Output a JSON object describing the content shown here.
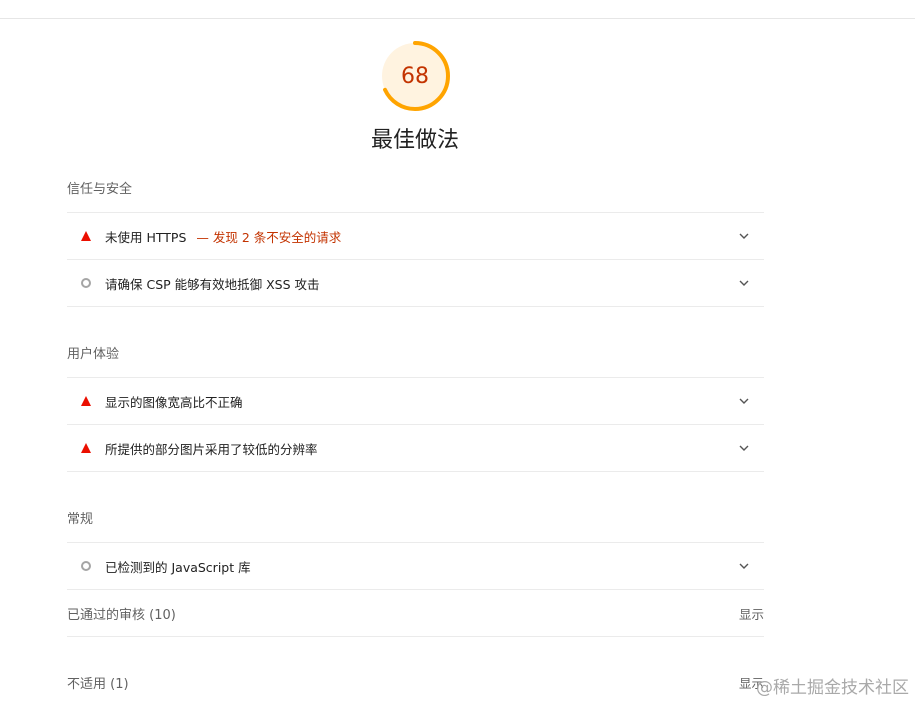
{
  "score": {
    "value": "68",
    "fraction": 0.68,
    "color": "#ffa400"
  },
  "category": {
    "title": "最佳做法"
  },
  "groups": [
    {
      "title": "信任与安全",
      "audits": [
        {
          "status": "fail",
          "icon": "warning-triangle-icon",
          "label": "未使用 HTTPS",
          "desc": "— 发现 2 条不安全的请求"
        },
        {
          "status": "info",
          "icon": "circle-icon",
          "label": "请确保 CSP 能够有效地抵御 XSS 攻击"
        }
      ]
    },
    {
      "title": "用户体验",
      "audits": [
        {
          "status": "fail",
          "icon": "warning-triangle-icon",
          "label": "显示的图像宽高比不正确"
        },
        {
          "status": "fail",
          "icon": "warning-triangle-icon",
          "label": "所提供的部分图片采用了较低的分辨率"
        }
      ]
    },
    {
      "title": "常规",
      "audits": [
        {
          "status": "info",
          "icon": "circle-icon",
          "label": "已检测到的 JavaScript 库"
        }
      ]
    }
  ],
  "passed": {
    "label": "已通过的审核",
    "count": "(10)",
    "toggle": "显示"
  },
  "notApplicable": {
    "label": "不适用",
    "count": "(1)",
    "toggle": "显示"
  },
  "watermark": "@稀土掘金技术社区",
  "colors": {
    "fail": "#eb0f00",
    "score_text": "#c33300",
    "info": "#a5a5a5"
  }
}
